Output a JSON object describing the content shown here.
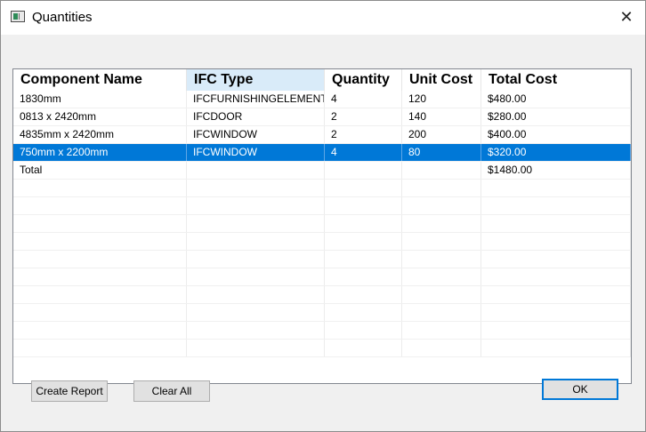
{
  "window": {
    "title": "Quantities",
    "icon": "window-app-icon",
    "close_glyph": "✕"
  },
  "table": {
    "columns": [
      "Component Name",
      "IFC Type",
      "Quantity",
      "Unit Cost",
      "Total Cost"
    ],
    "rows": [
      [
        "1830mm",
        "IFCFURNISHINGELEMENT",
        "4",
        "120",
        "$480.00"
      ],
      [
        "0813 x 2420mm",
        "IFCDOOR",
        "2",
        "140",
        "$280.00"
      ],
      [
        "4835mm x 2420mm",
        "IFCWINDOW",
        "2",
        "200",
        "$400.00"
      ],
      [
        "750mm x 2200mm",
        "IFCWINDOW",
        "4",
        "80",
        "$320.00"
      ],
      [
        "Total",
        "",
        "",
        "",
        "$1480.00"
      ]
    ],
    "selected_row_index": 3,
    "empty_row_count": 10
  },
  "buttons": {
    "create_report": "Create Report",
    "clear_all": "Clear All",
    "ok": "OK"
  },
  "colors": {
    "selection": "#0078d7",
    "header_highlight": "#d9ebf9",
    "default_button_border": "#0078d7"
  }
}
